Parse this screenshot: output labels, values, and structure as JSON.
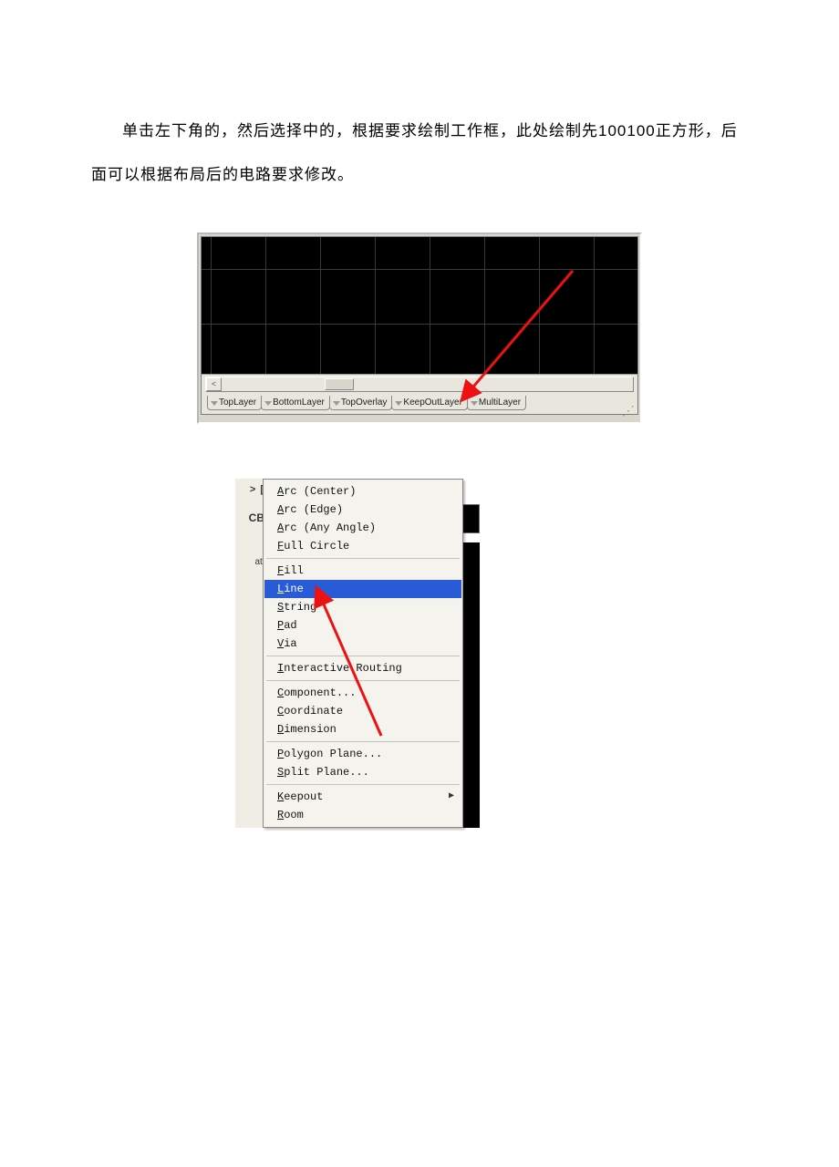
{
  "text": {
    "paragraph": "单击左下角的，然后选择中的，根据要求绘制工作框，此处绘制先100100正方形，后面可以根据布局后的电路要求修改。"
  },
  "figure1": {
    "tabs": [
      "TopLayer",
      "BottomLayer",
      "TopOverlay",
      "KeepOutLayer",
      "MultiLayer"
    ],
    "highlighted_tab": "KeepOutLayer",
    "scroll_label": "<"
  },
  "figure2": {
    "left_labels": {
      "top": "> [",
      "cb": "CB",
      "ati": "ati"
    },
    "items": [
      {
        "label": "Arc (Center)"
      },
      {
        "label": "Arc (Edge)"
      },
      {
        "label": "Arc (Any Angle)"
      },
      {
        "label": "Full Circle"
      },
      {
        "sep": true
      },
      {
        "label": "Fill"
      },
      {
        "label": "Line",
        "highlight": true
      },
      {
        "label": "String"
      },
      {
        "label": "Pad"
      },
      {
        "label": "Via"
      },
      {
        "sep": true
      },
      {
        "label": "Interactive Routing"
      },
      {
        "sep": true
      },
      {
        "label": "Component..."
      },
      {
        "label": "Coordinate"
      },
      {
        "label": "Dimension"
      },
      {
        "sep": true
      },
      {
        "label": "Polygon Plane..."
      },
      {
        "label": "Split Plane..."
      },
      {
        "sep": true
      },
      {
        "label": "Keepout",
        "submenu": true
      },
      {
        "label": "Room"
      }
    ]
  }
}
